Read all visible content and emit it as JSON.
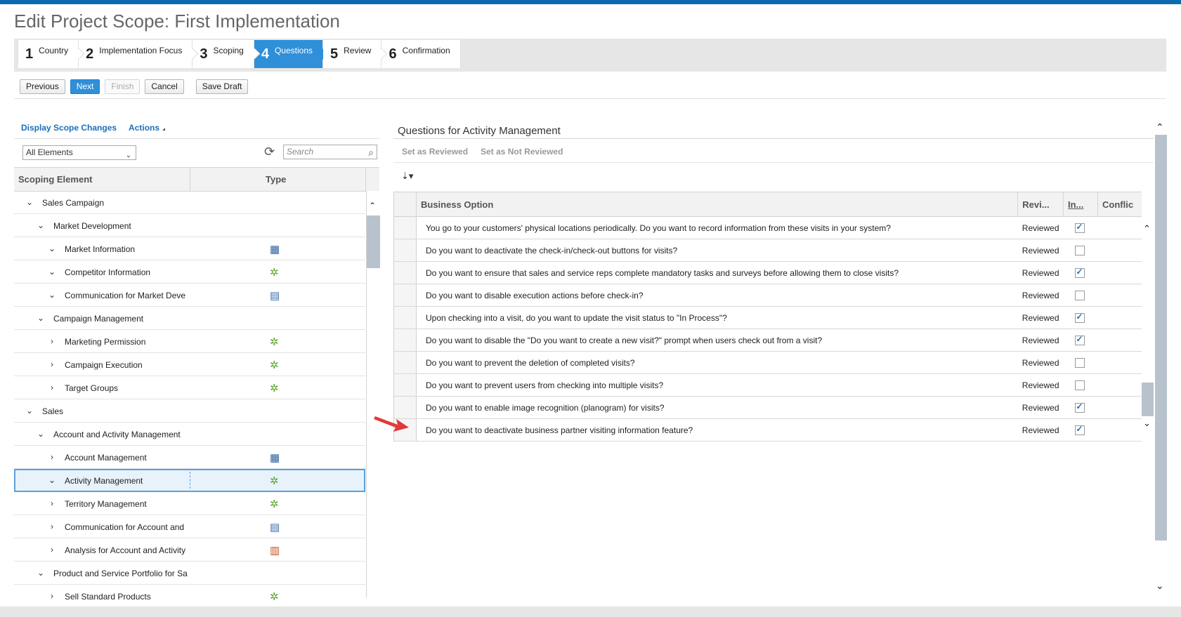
{
  "page_title": "Edit Project Scope: First Implementation",
  "wizard_steps": [
    {
      "num": "1",
      "label": "Country"
    },
    {
      "num": "2",
      "label": "Implementation Focus"
    },
    {
      "num": "3",
      "label": "Scoping"
    },
    {
      "num": "4",
      "label": "Questions"
    },
    {
      "num": "5",
      "label": "Review"
    },
    {
      "num": "6",
      "label": "Confirmation"
    }
  ],
  "toolbar": {
    "previous": "Previous",
    "next": "Next",
    "finish": "Finish",
    "cancel": "Cancel",
    "save_draft": "Save Draft"
  },
  "left": {
    "display_scope_changes": "Display Scope Changes",
    "actions": "Actions",
    "filter_value": "All Elements",
    "search_placeholder": "Search",
    "col_scoping_element": "Scoping Element",
    "col_type": "Type",
    "tree": [
      {
        "label": "Sales Campaign",
        "level": 0,
        "exp": "down",
        "icon": ""
      },
      {
        "label": "Market Development",
        "level": 1,
        "exp": "down",
        "icon": ""
      },
      {
        "label": "Market Information",
        "level": 2,
        "exp": "down",
        "icon": "grid-icon"
      },
      {
        "label": "Competitor Information",
        "level": 2,
        "exp": "down",
        "icon": "gear-icon"
      },
      {
        "label": "Communication for Market Deve",
        "level": 2,
        "exp": "down",
        "icon": "document-icon"
      },
      {
        "label": "Campaign Management",
        "level": 1,
        "exp": "down",
        "icon": ""
      },
      {
        "label": "Marketing Permission",
        "level": 2,
        "exp": "right",
        "icon": "gear-icon"
      },
      {
        "label": "Campaign Execution",
        "level": 2,
        "exp": "right",
        "icon": "gear-icon"
      },
      {
        "label": "Target Groups",
        "level": 2,
        "exp": "right",
        "icon": "gear-icon"
      },
      {
        "label": "Sales",
        "level": 0,
        "exp": "down",
        "icon": ""
      },
      {
        "label": "Account and Activity Management",
        "level": 1,
        "exp": "down",
        "icon": ""
      },
      {
        "label": "Account Management",
        "level": 2,
        "exp": "right",
        "icon": "grid-icon"
      },
      {
        "label": "Activity Management",
        "level": 2,
        "exp": "down",
        "icon": "gear-icon",
        "selected": true
      },
      {
        "label": "Territory Management",
        "level": 2,
        "exp": "right",
        "icon": "gear-icon"
      },
      {
        "label": "Communication for Account and",
        "level": 2,
        "exp": "right",
        "icon": "document-icon"
      },
      {
        "label": "Analysis for Account and Activity",
        "level": 2,
        "exp": "right",
        "icon": "chart-icon"
      },
      {
        "label": "Product and Service Portfolio for Sa",
        "level": 1,
        "exp": "down",
        "icon": ""
      },
      {
        "label": "Sell Standard Products",
        "level": 2,
        "exp": "right",
        "icon": "gear-icon"
      }
    ]
  },
  "right": {
    "title": "Questions for Activity Management",
    "set_reviewed": "Set as Reviewed",
    "set_not_reviewed": "Set as Not Reviewed",
    "columns": {
      "business_option": "Business Option",
      "reviewed": "Revi...",
      "in": "In...",
      "conflict": "Conflic"
    },
    "rows": [
      {
        "option": "You go to your customers' physical locations periodically. Do you want to record information from these visits in your system?",
        "status": "Reviewed",
        "checked": true
      },
      {
        "option": "Do you want to deactivate the check-in/check-out buttons for visits?",
        "status": "Reviewed",
        "checked": false
      },
      {
        "option": "Do you want to ensure that sales and service reps complete mandatory tasks and surveys before allowing them to close visits?",
        "status": "Reviewed",
        "checked": true
      },
      {
        "option": "Do you want to disable execution actions before check-in?",
        "status": "Reviewed",
        "checked": false
      },
      {
        "option": "Upon checking into a visit, do you want to update the visit status to \"In Process\"?",
        "status": "Reviewed",
        "checked": true
      },
      {
        "option": "Do you want to disable the \"Do you want to create a new visit?\" prompt when users check out from a visit?",
        "status": "Reviewed",
        "checked": true
      },
      {
        "option": "Do you want to prevent the deletion of completed visits?",
        "status": "Reviewed",
        "checked": false
      },
      {
        "option": "Do you want to prevent users from checking into multiple visits?",
        "status": "Reviewed",
        "checked": false
      },
      {
        "option": "Do you want to enable image recognition (planogram) for visits?",
        "status": "Reviewed",
        "checked": true
      },
      {
        "option": "Do you want to deactivate business partner visiting information feature?",
        "status": "Reviewed",
        "checked": true
      }
    ]
  },
  "colors": {
    "accent": "#2f8fd8",
    "topbar": "#0a6ab0",
    "link": "#1d6fb8",
    "gear_icon": "#5aa62a",
    "arrow": "#e03a3a"
  }
}
